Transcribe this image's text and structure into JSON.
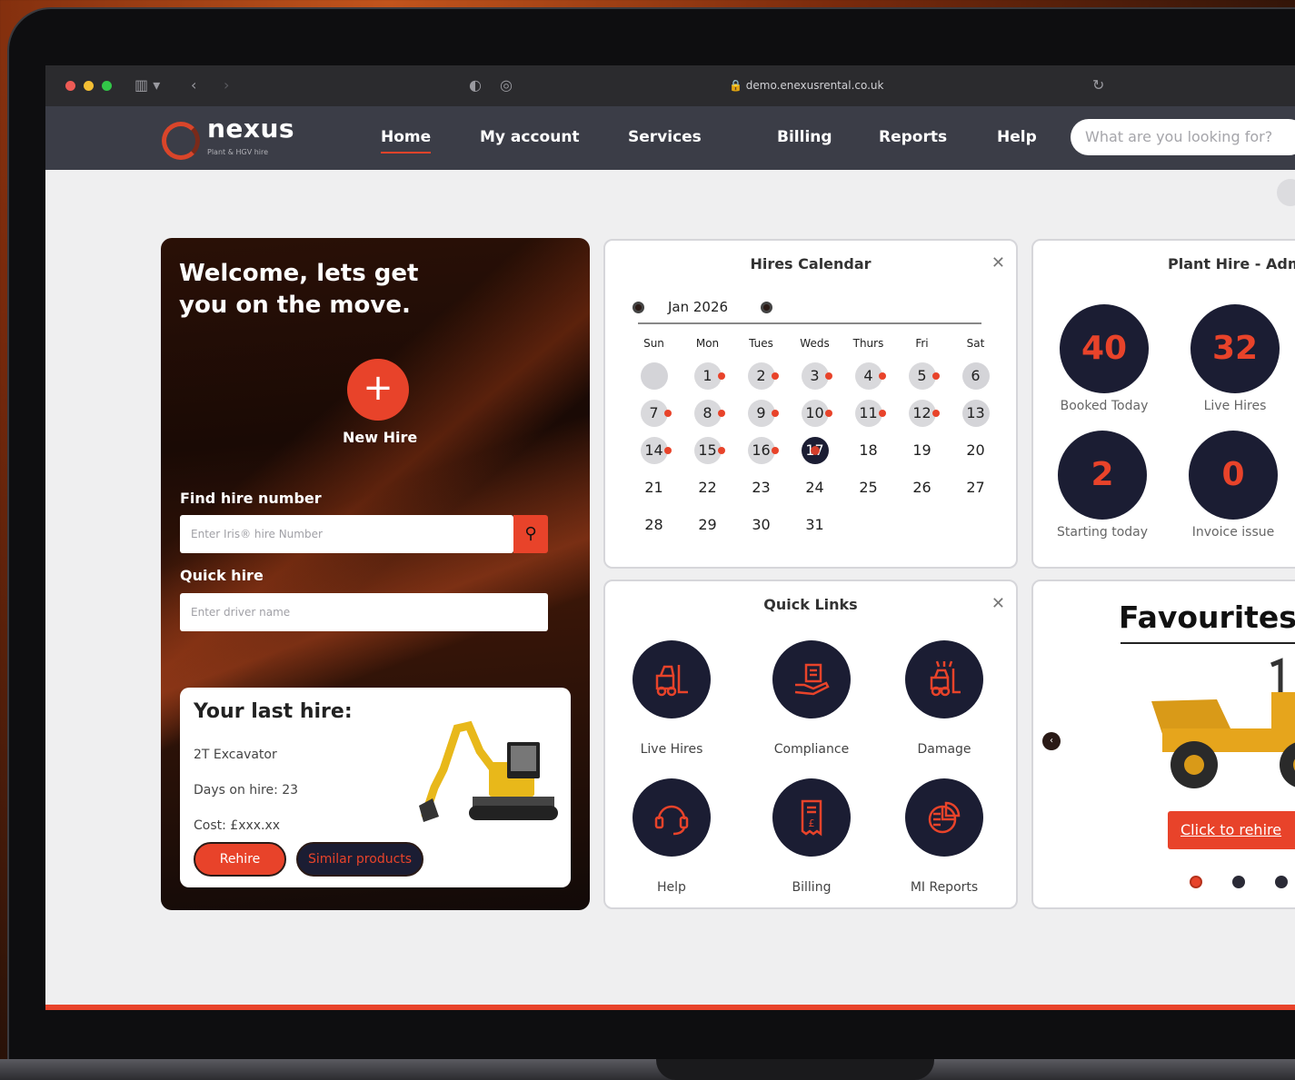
{
  "browser": {
    "url": "demo.enexusrental.co.uk"
  },
  "brand": {
    "name": "nexus",
    "tagline": "Plant & HGV hire",
    "accent": "#e8432a",
    "navy": "#1b1d33"
  },
  "nav": {
    "items": [
      {
        "label": "Home",
        "active": true
      },
      {
        "label": "My account"
      },
      {
        "label": "Services"
      },
      {
        "label": "Billing"
      },
      {
        "label": "Reports"
      },
      {
        "label": "Help"
      }
    ],
    "search_placeholder": "What are you looking for?"
  },
  "welcome": {
    "heading_line1": "Welcome, lets get",
    "heading_line2": "you on the move.",
    "new_hire_label": "New Hire",
    "find_label": "Find hire number",
    "find_placeholder": "Enter Iris® hire Number",
    "quick_label": "Quick hire",
    "quick_placeholder": "Enter driver name",
    "last_hire": {
      "title": "Your last hire:",
      "item": "2T Excavator",
      "days": "Days on hire: 23",
      "cost": "Cost: £xxx.xx",
      "rehire": "Rehire",
      "similar": "Similar products"
    }
  },
  "calendar": {
    "title": "Hires Calendar",
    "month": "Jan 2026",
    "weekdays": [
      "Sun",
      "Mon",
      "Tues",
      "Weds",
      "Thurs",
      "Fri",
      "Sat"
    ],
    "weeks": [
      [
        "",
        "1",
        "2",
        "3",
        "4",
        "5",
        "6"
      ],
      [
        "7",
        "8",
        "9",
        "10",
        "11",
        "12",
        "13"
      ],
      [
        "14",
        "15",
        "16",
        "17",
        "18",
        "19",
        "20"
      ],
      [
        "21",
        "22",
        "23",
        "24",
        "25",
        "26",
        "27"
      ],
      [
        "28",
        "29",
        "30",
        "31",
        "",
        "",
        ""
      ]
    ],
    "booked_days": [
      "1",
      "2",
      "3",
      "4",
      "5",
      "7",
      "8",
      "9",
      "10",
      "11",
      "12",
      "14",
      "15",
      "16"
    ],
    "grey_days": [
      "6",
      "13"
    ],
    "today": "17"
  },
  "admin": {
    "title": "Plant Hire - Admin",
    "stats": [
      {
        "value": "40",
        "label": "Booked Today"
      },
      {
        "value": "32",
        "label": "Live Hires"
      },
      {
        "value": "2",
        "label": "Starting today"
      },
      {
        "value": "0",
        "label": "Invoice issue"
      }
    ]
  },
  "quick_links": {
    "title": "Quick Links",
    "items": [
      {
        "label": "Live Hires",
        "icon": "forklift-icon"
      },
      {
        "label": "Compliance",
        "icon": "hand-document-icon"
      },
      {
        "label": "Damage",
        "icon": "damaged-forklift-icon"
      },
      {
        "label": "Help",
        "icon": "headset-icon"
      },
      {
        "label": "Billing",
        "icon": "invoice-icon"
      },
      {
        "label": "MI Reports",
        "icon": "pie-chart-icon"
      }
    ]
  },
  "favourites": {
    "title": "Favourites hire",
    "button": "Click to rehire",
    "slides": 3,
    "active_slide": 1
  }
}
